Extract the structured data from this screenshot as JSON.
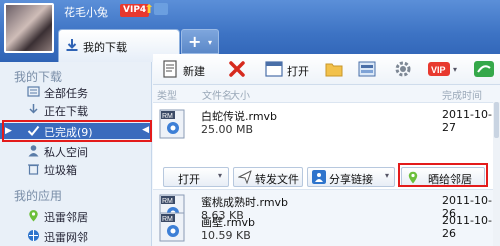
{
  "user": {
    "name": "花毛小兔",
    "vip_level": "VIP4",
    "vip_arrow": "⬆"
  },
  "tabs": {
    "active_label": "我的下载",
    "add_symbol": "+",
    "add_caret": "▾"
  },
  "sidebar": {
    "group1_label": "我的下载",
    "items": [
      {
        "label": "全部任务",
        "icon": "folder-icon"
      },
      {
        "label": "正在下载",
        "icon": "download-arrow-icon"
      },
      {
        "label": "已完成(9)",
        "icon": "checkmark-icon",
        "selected": true
      },
      {
        "label": "私人空间",
        "icon": "person-icon"
      },
      {
        "label": "垃圾箱",
        "icon": "trash-icon"
      }
    ],
    "group2_label": "我的应用",
    "apps": [
      {
        "label": "迅雷邻居",
        "icon": "location-pin-icon"
      },
      {
        "label": "迅雷网邻",
        "icon": "network-icon"
      }
    ],
    "arrow_left": "▶",
    "arrow_right": "◀"
  },
  "toolbar": {
    "new_label": "新建",
    "open_label": "打开"
  },
  "list_header": {
    "type": "类型",
    "filename": "文件名",
    "size": "大小",
    "done_time": "完成时间"
  },
  "files": [
    {
      "name": "白蛇传说.rmvb",
      "size": "25.00 MB",
      "date": "2011-10-27",
      "badge": "RM"
    },
    {
      "name": "蜜桃成熟时.rmvb",
      "size": "8.63 KB",
      "date": "2011-10-26",
      "badge": "RM"
    },
    {
      "name": "画壁.rmvb",
      "size": "10.59 KB",
      "date": "2011-10-26",
      "badge": "RM"
    }
  ],
  "actions": {
    "open_label": "打开",
    "forward_label": "转发文件",
    "share_label": "分享链接",
    "neighbor_label": "晒给邻居",
    "caret": "▾"
  },
  "colors": {
    "accent": "#3a6bbd",
    "highlight": "#e31b1b",
    "vip": "#e8392f"
  }
}
